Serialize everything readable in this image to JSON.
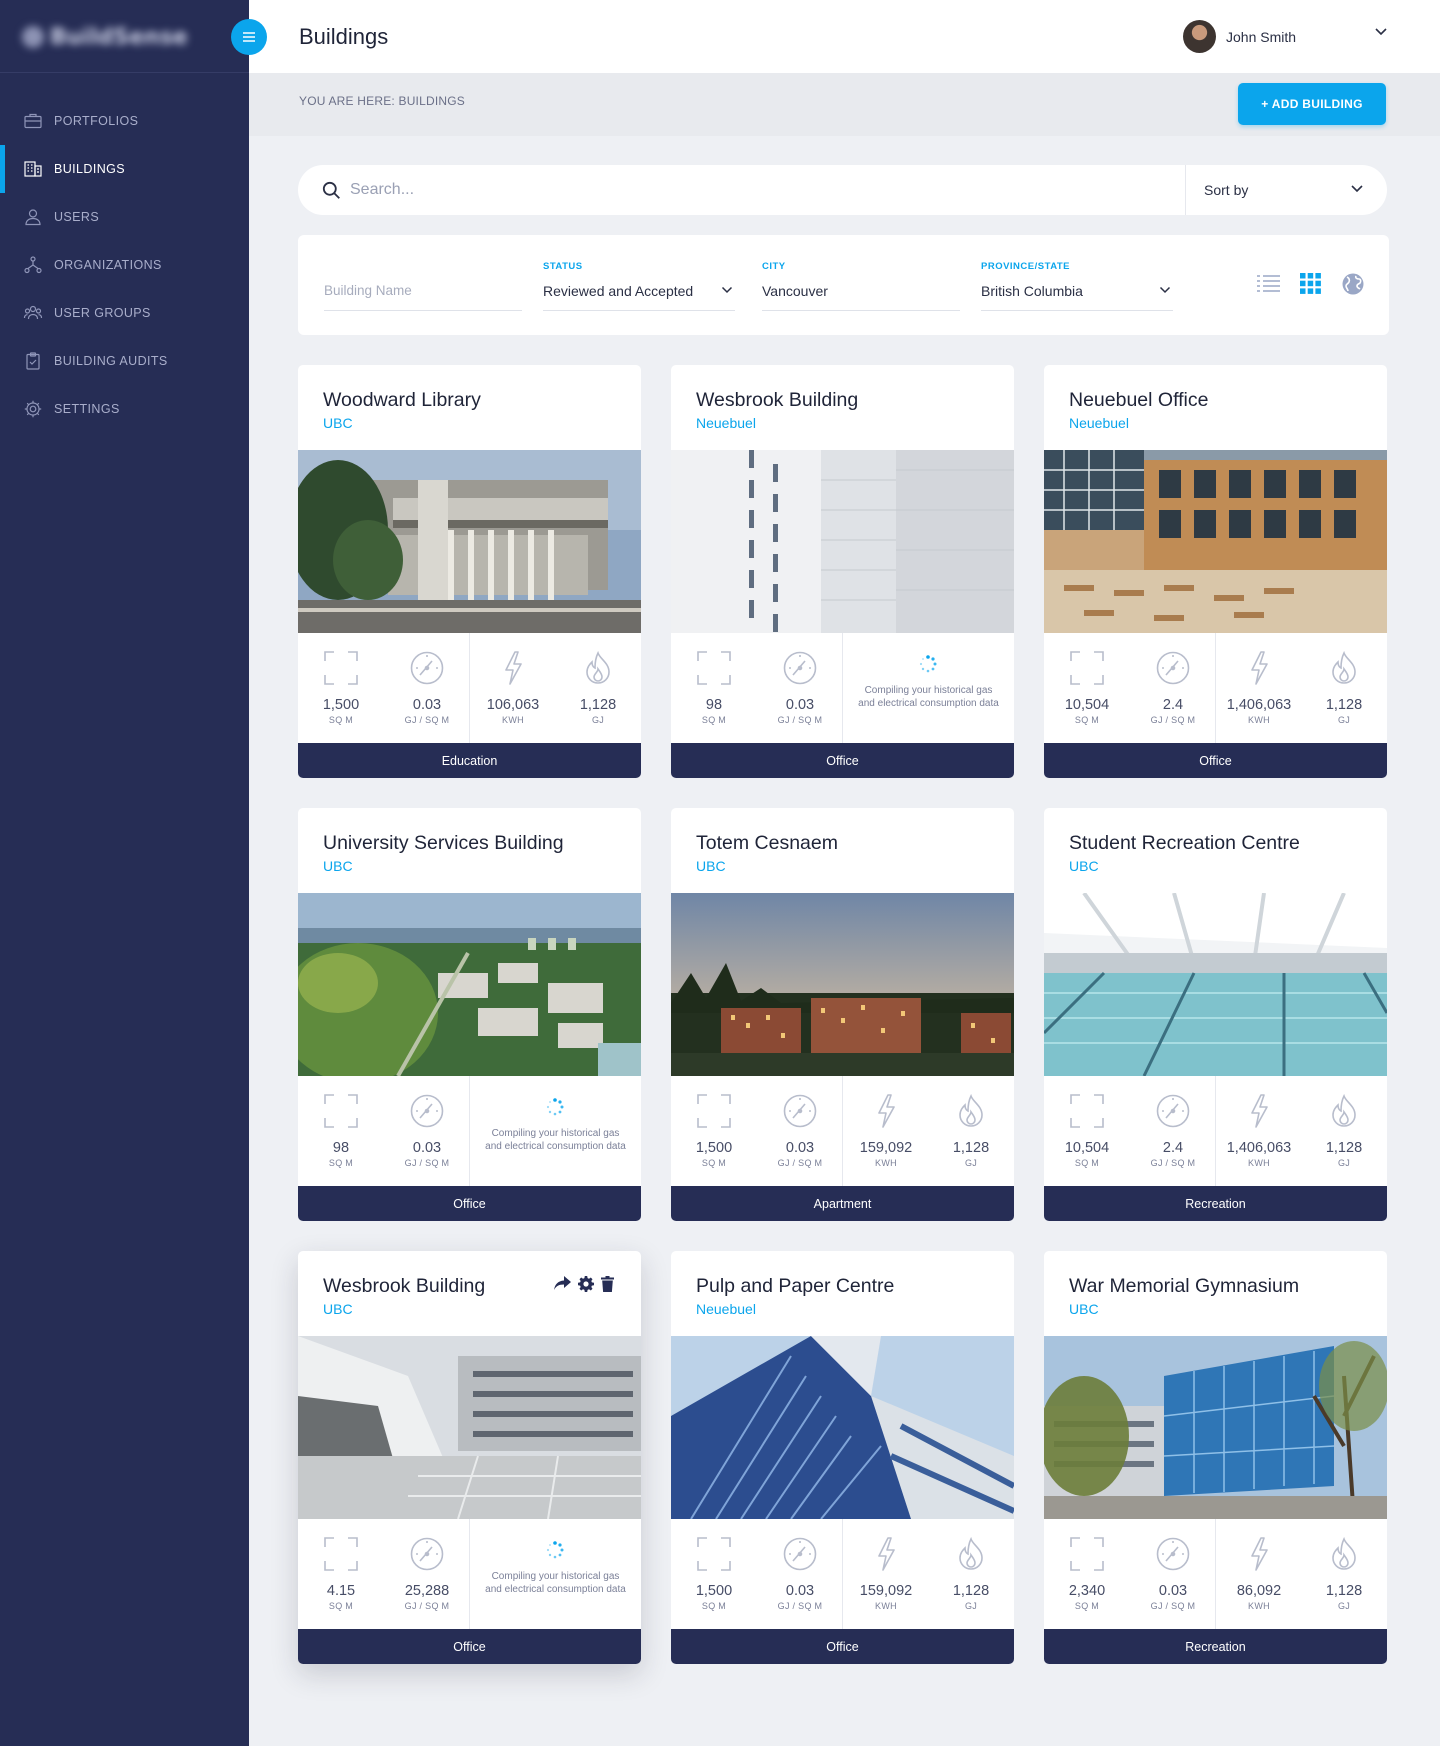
{
  "app": {
    "logo_text": "BuildSense"
  },
  "header": {
    "title": "Buildings",
    "user_name": "John Smith"
  },
  "breadcrumb": "YOU ARE HERE: BUILDINGS",
  "add_button": "+ ADD BUILDING",
  "sidebar": {
    "items": [
      {
        "label": "PORTFOLIOS",
        "icon": "briefcase-icon",
        "active": false
      },
      {
        "label": "BUILDINGS",
        "icon": "building-icon",
        "active": true
      },
      {
        "label": "USERS",
        "icon": "user-icon",
        "active": false
      },
      {
        "label": "ORGANIZATIONS",
        "icon": "org-chart-icon",
        "active": false
      },
      {
        "label": "USER GROUPS",
        "icon": "user-group-icon",
        "active": false
      },
      {
        "label": "BUILDING AUDITS",
        "icon": "clipboard-icon",
        "active": false
      },
      {
        "label": "SETTINGS",
        "icon": "gear-icon",
        "active": false
      }
    ]
  },
  "search": {
    "placeholder": "Search...",
    "sort_label": "Sort by"
  },
  "filters": {
    "name_placeholder": "Building Name",
    "status": {
      "label": "STATUS",
      "value": "Reviewed and Accepted"
    },
    "city": {
      "label": "CITY",
      "value": "Vancouver"
    },
    "province": {
      "label": "PROVINCE/STATE",
      "value": "British Columbia"
    },
    "views": [
      "list-view-icon",
      "grid-view-icon",
      "globe-view-icon"
    ]
  },
  "compiling_text": "Compiling your historical gas and electrical consumption data",
  "units": {
    "area": "SQ M",
    "intensity": "GJ / SQ M",
    "elec": "KWH",
    "gas": "GJ"
  },
  "cards": [
    {
      "title": "Woodward Library",
      "org": "UBC",
      "area": "1,500",
      "intensity": "0.03",
      "kwh": "106,063",
      "gj": "1,128",
      "type": "Education"
    },
    {
      "title": "Wesbrook Building",
      "org": "Neuebuel",
      "area": "98",
      "intensity": "0.03",
      "type": "Office"
    },
    {
      "title": "Neuebuel Office",
      "org": "Neuebuel",
      "area": "10,504",
      "intensity": "2.4",
      "kwh": "1,406,063",
      "gj": "1,128",
      "type": "Office"
    },
    {
      "title": "University Services Building",
      "org": "UBC",
      "area": "98",
      "intensity": "0.03",
      "type": "Office"
    },
    {
      "title": "Totem Cesnaem",
      "org": "UBC",
      "area": "1,500",
      "intensity": "0.03",
      "kwh": "159,092",
      "gj": "1,128",
      "type": "Apartment"
    },
    {
      "title": "Student Recreation Centre",
      "org": "UBC",
      "area": "10,504",
      "intensity": "2.4",
      "kwh": "1,406,063",
      "gj": "1,128",
      "type": "Recreation"
    },
    {
      "title": "Wesbrook Building",
      "org": "UBC",
      "area": "4.15",
      "intensity": "25,288",
      "type": "Office"
    },
    {
      "title": "Pulp and Paper Centre",
      "org": "Neuebuel",
      "area": "1,500",
      "intensity": "0.03",
      "kwh": "159,092",
      "gj": "1,128",
      "type": "Office"
    },
    {
      "title": "War Memorial Gymnasium",
      "org": "UBC",
      "area": "2,340",
      "intensity": "0.03",
      "kwh": "86,092",
      "gj": "1,128",
      "type": "Recreation"
    }
  ],
  "colors": {
    "accent": "#0ba5ec",
    "sidebar": "#262d55",
    "background": "#eef0f4"
  }
}
